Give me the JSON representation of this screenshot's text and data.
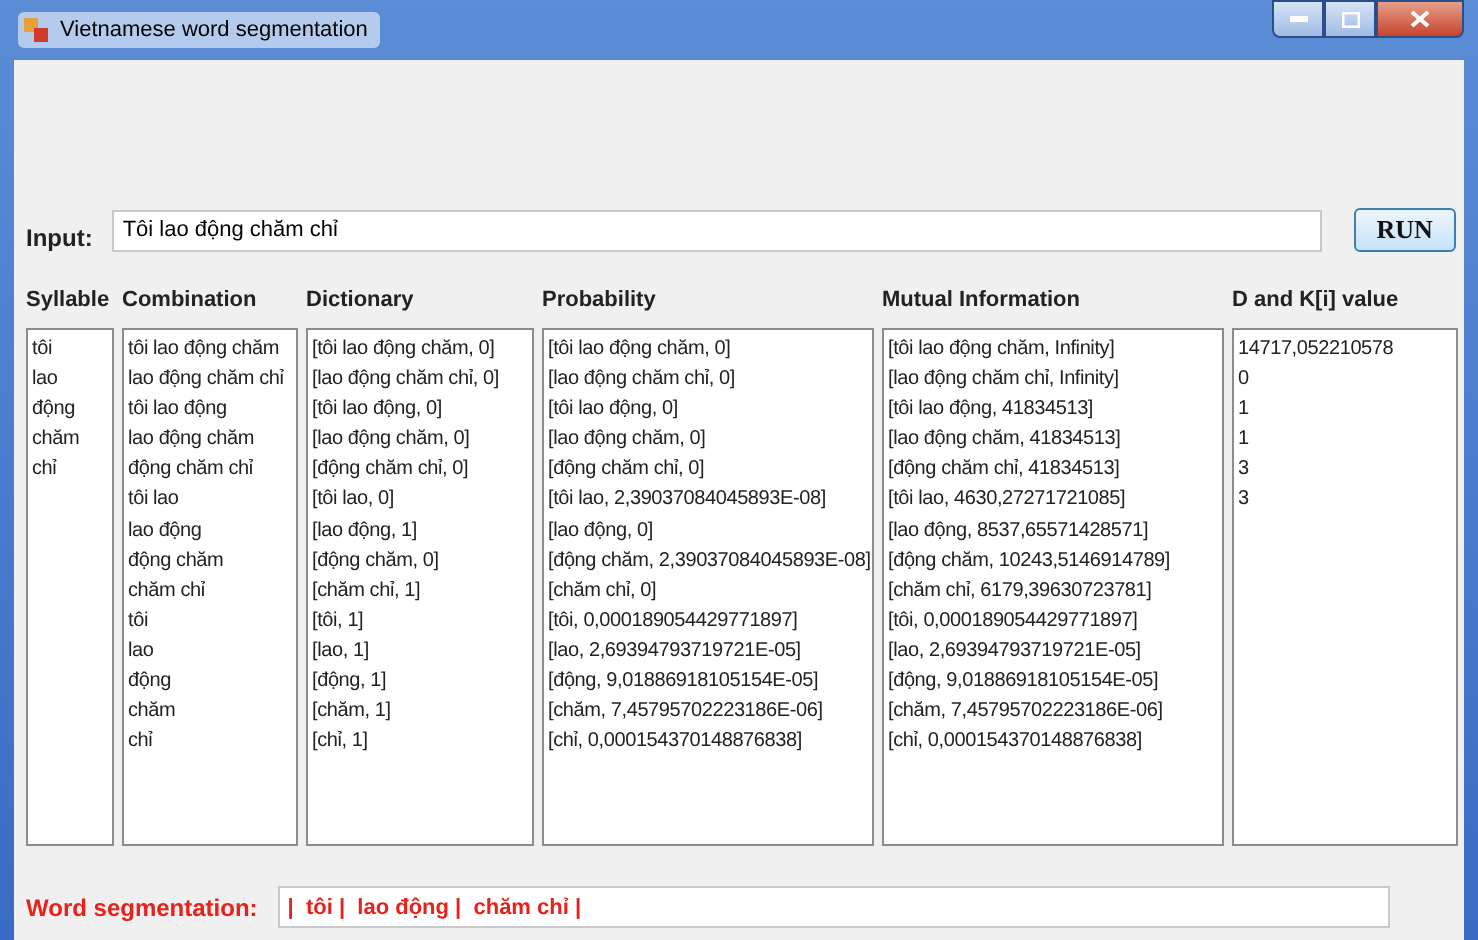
{
  "window": {
    "title": "Vietnamese word segmentation"
  },
  "input": {
    "label": "Input:",
    "value": "Tôi lao động chăm chỉ"
  },
  "run_button": {
    "label": "RUN"
  },
  "columns": [
    {
      "heading": "Syllable",
      "lines": [
        "tôi",
        "lao",
        "động",
        "chăm",
        "chỉ"
      ]
    },
    {
      "heading": "Combination",
      "lines": [
        "tôi lao động chăm",
        "lao động chăm chỉ",
        "tôi lao động",
        "lao động chăm",
        "động chăm chỉ",
        "tôi lao",
        "lao động",
        "động chăm",
        "chăm chỉ",
        "tôi",
        "lao",
        "động",
        "chăm",
        "chỉ"
      ]
    },
    {
      "heading": "Dictionary",
      "lines": [
        "[tôi lao động chăm, 0]",
        "[lao động chăm chỉ, 0]",
        "[tôi lao động, 0]",
        "[lao động chăm, 0]",
        "[động chăm chỉ, 0]",
        "[tôi lao, 0]",
        "[lao động, 1]",
        "[động chăm, 0]",
        "[chăm chỉ, 1]",
        "[tôi, 1]",
        "[lao, 1]",
        "[động, 1]",
        "[chăm, 1]",
        "[chỉ, 1]"
      ]
    },
    {
      "heading": "Probability",
      "lines": [
        "[tôi lao động chăm, 0]",
        "[lao động chăm chỉ, 0]",
        "[tôi lao động, 0]",
        "[lao động chăm, 0]",
        "[động chăm chỉ, 0]",
        "[tôi lao, 2,39037084045893E-08]",
        "[lao động, 0]",
        "[động chăm, 2,39037084045893E-08]",
        "[chăm chỉ, 0]",
        "[tôi, 0,000189054429771897]",
        "[lao, 2,69394793719721E-05]",
        "[động, 9,01886918105154E-05]",
        "[chăm, 7,45795702223186E-06]",
        "[chỉ, 0,000154370148876838]"
      ]
    },
    {
      "heading": "Mutual Information",
      "lines": [
        "[tôi lao động chăm, Infinity]",
        "[lao động chăm chỉ, Infinity]",
        "[tôi lao động, 41834513]",
        "[lao động chăm, 41834513]",
        "[động chăm chỉ, 41834513]",
        "[tôi lao, 4630,27271721085]",
        "[lao động, 8537,65571428571]",
        "[động chăm, 10243,5146914789]",
        "[chăm chỉ, 6179,39630723781]",
        "[tôi, 0,000189054429771897]",
        "[lao, 2,69394793719721E-05]",
        "[động, 9,01886918105154E-05]",
        "[chăm, 7,45795702223186E-06]",
        "[chỉ, 0,000154370148876838]"
      ]
    },
    {
      "heading": "D and K[i] value",
      "lines": [
        "14717,052210578",
        "0",
        "1",
        "1",
        "3",
        "3"
      ]
    }
  ],
  "segmentation": {
    "label": "Word segmentation:",
    "value": "|  tôi |  lao động |  chăm chỉ |"
  }
}
